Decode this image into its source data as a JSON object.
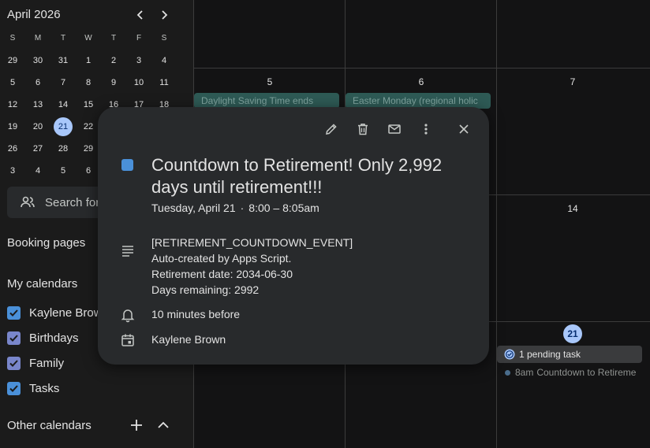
{
  "mini_calendar": {
    "month_label": "April 2026",
    "prev_icon": "chevron-left-icon",
    "next_icon": "chevron-right-icon",
    "weekdays": [
      "S",
      "M",
      "T",
      "W",
      "T",
      "F",
      "S"
    ],
    "weeks": [
      [
        "29",
        "30",
        "31",
        "1",
        "2",
        "3",
        "4"
      ],
      [
        "5",
        "6",
        "7",
        "8",
        "9",
        "10",
        "11"
      ],
      [
        "12",
        "13",
        "14",
        "15",
        "16",
        "17",
        "18"
      ],
      [
        "19",
        "20",
        "21",
        "22",
        "",
        "",
        ""
      ],
      [
        "26",
        "27",
        "28",
        "29",
        "",
        "",
        ""
      ],
      [
        "3",
        "4",
        "5",
        "6",
        "",
        "",
        ""
      ]
    ],
    "today": "21"
  },
  "sidebar": {
    "search_label": "Search for",
    "booking_pages": "Booking pages",
    "my_calendars_heading": "My calendars",
    "my_calendars": [
      {
        "name": "Kaylene Brown",
        "color": "#4a90d9"
      },
      {
        "name": "Birthdays",
        "color": "#7986cb"
      },
      {
        "name": "Family",
        "color": "#7986cb"
      },
      {
        "name": "Tasks",
        "color": "#4a90d9"
      }
    ],
    "other_calendars_heading": "Other calendars"
  },
  "grid": {
    "days": [
      {
        "num": "5"
      },
      {
        "num": "6"
      },
      {
        "num": "7"
      },
      {
        "num": "14"
      }
    ],
    "allday_events": [
      {
        "label": "Daylight Saving Time ends"
      },
      {
        "label": "Easter Monday (regional holic"
      }
    ],
    "today_num": "21",
    "task_chip": "1 pending task",
    "event_time": "8am",
    "event_title": "Countdown to Retireme"
  },
  "popup": {
    "title": "Countdown to Retirement! Only 2,992 days until retirement!!!",
    "date": "Tuesday, April 21",
    "separator": "·",
    "time": "8:00 – 8:05am",
    "description_lines": [
      "[RETIREMENT_COUNTDOWN_EVENT]",
      "Auto-created by Apps Script.",
      "Retirement date: 2034-06-30",
      "Days remaining: 2992"
    ],
    "reminder": "10 minutes before",
    "calendar": "Kaylene Brown",
    "event_color": "#4a90d9"
  },
  "colors": {
    "today_accent": "#a8c7fa",
    "holiday_chip": "#2e5a55"
  }
}
